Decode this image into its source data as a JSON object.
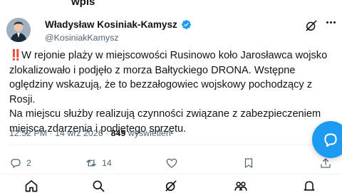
{
  "header": {
    "title_cut": "wpis"
  },
  "author": {
    "display_name": "Władysław Kosiniak-Kamysz",
    "handle": "@KosiniakKamysz",
    "verified": true,
    "verified_color": "#1d9bf0"
  },
  "post": {
    "emoji": "‼️",
    "paragraph1": "W rejonie plaży w miejscowości Rusinowo koło Jarosławca wojsko zlokalizowało i podjęło z morza Bałtyckiego DRONA. Wstępne oględziny wskazują, że to bezzałogowiec wojskowy pochodzący z Rosji.",
    "paragraph2": "Na miejscu służby realizują czynności związane z zabezpieczeniem miejsca zdarzenia i podjętego sprzętu."
  },
  "meta": {
    "time": "12:52 PM",
    "separator": "·",
    "date": "14 wrz 2026",
    "views_count": "849",
    "views_label": "wyświetleń"
  },
  "actions": {
    "replies": "2",
    "reposts": "14",
    "likes": "",
    "bookmarks": ""
  },
  "colors": {
    "accent": "#1d9bf0",
    "text": "#0f1419",
    "secondary": "#536471"
  },
  "icons": [
    "grok-icon",
    "more-icon",
    "reply-icon",
    "repost-icon",
    "like-icon",
    "bookmark-icon",
    "share-icon",
    "compose-icon",
    "home-icon",
    "search-icon",
    "grok-nav-icon",
    "communities-icon",
    "notifications-icon"
  ]
}
